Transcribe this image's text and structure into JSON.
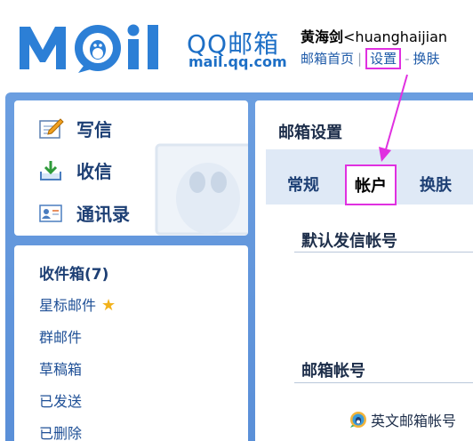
{
  "header": {
    "logo_text": "MOil",
    "brand": "QQ邮箱",
    "domain": "mail.qq.com",
    "user_line": "黄海剑<huanghaijian",
    "user_name": "黄海剑",
    "user_email_partial": "<huanghaijian",
    "links": [
      {
        "label": "邮箱首页"
      },
      {
        "label": "设置"
      },
      {
        "label": "换肤"
      }
    ]
  },
  "sidebar": {
    "actions": [
      {
        "label": "写信",
        "icon": "compose-icon"
      },
      {
        "label": "收信",
        "icon": "inbox-download-icon"
      },
      {
        "label": "通讯录",
        "icon": "contacts-icon"
      }
    ],
    "folders": [
      {
        "label": "收件箱(7)"
      },
      {
        "label": "星标邮件",
        "icon": "star-icon"
      },
      {
        "label": "群邮件"
      },
      {
        "label": "草稿箱"
      },
      {
        "label": "已发送"
      },
      {
        "label": "已删除"
      }
    ]
  },
  "settings": {
    "title": "邮箱设置",
    "tabs": [
      {
        "label": "常规"
      },
      {
        "label": "帐户",
        "active": true
      },
      {
        "label": "换肤"
      }
    ],
    "sections": [
      {
        "title": "默认发信帐号"
      },
      {
        "title": "邮箱帐号"
      }
    ],
    "account_item": "英文邮箱帐号"
  },
  "colors": {
    "frame_blue": "#5a8fd8",
    "brand_blue": "#1d6fc6",
    "highlight": "#e030e0",
    "tab_bar": "#dfe9f6"
  }
}
